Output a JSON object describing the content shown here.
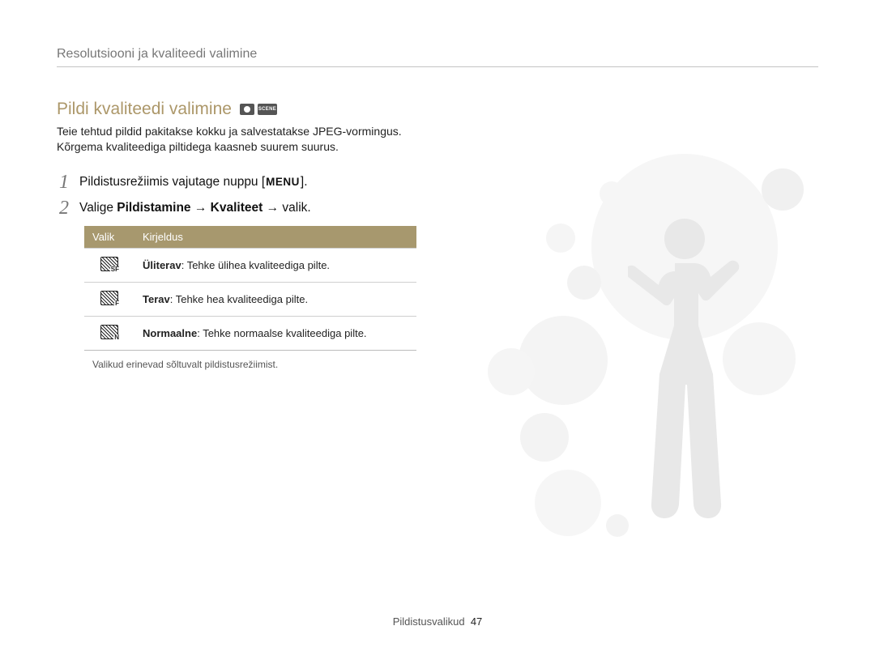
{
  "breadcrumb": "Resolutsiooni ja kvaliteedi valimine",
  "section_title": "Pildi kvaliteedi valimine",
  "mode_icons": {
    "scene_label": "SCENE"
  },
  "intro": "Teie tehtud pildid pakitakse kokku ja salvestatakse JPEG-vormingus. Kõrgema kvaliteediga piltidega kaasneb suurem suurus.",
  "steps": [
    {
      "num": "1",
      "prefix": "Pildistusrežiimis vajutage nuppu [",
      "badge": "MENU",
      "suffix": "]."
    },
    {
      "num": "2",
      "prefix": "Valige ",
      "bold": "Pildistamine → Kvaliteet",
      "suffix2": " → valik."
    }
  ],
  "table": {
    "headers": {
      "col1": "Valik",
      "col2": "Kirjeldus"
    },
    "rows": [
      {
        "icon_letter": "SF",
        "name": "Üliterav",
        "desc": ": Tehke ülihea kvaliteediga pilte."
      },
      {
        "icon_letter": "F",
        "name": "Terav",
        "desc": ": Tehke hea kvaliteediga pilte."
      },
      {
        "icon_letter": "N",
        "name": "Normaalne",
        "desc": ": Tehke normaalse kvaliteediga pilte."
      }
    ],
    "note": "Valikud erinevad sõltuvalt pildistusrežiimist."
  },
  "footer": {
    "section": "Pildistusvalikud",
    "page": "47"
  }
}
